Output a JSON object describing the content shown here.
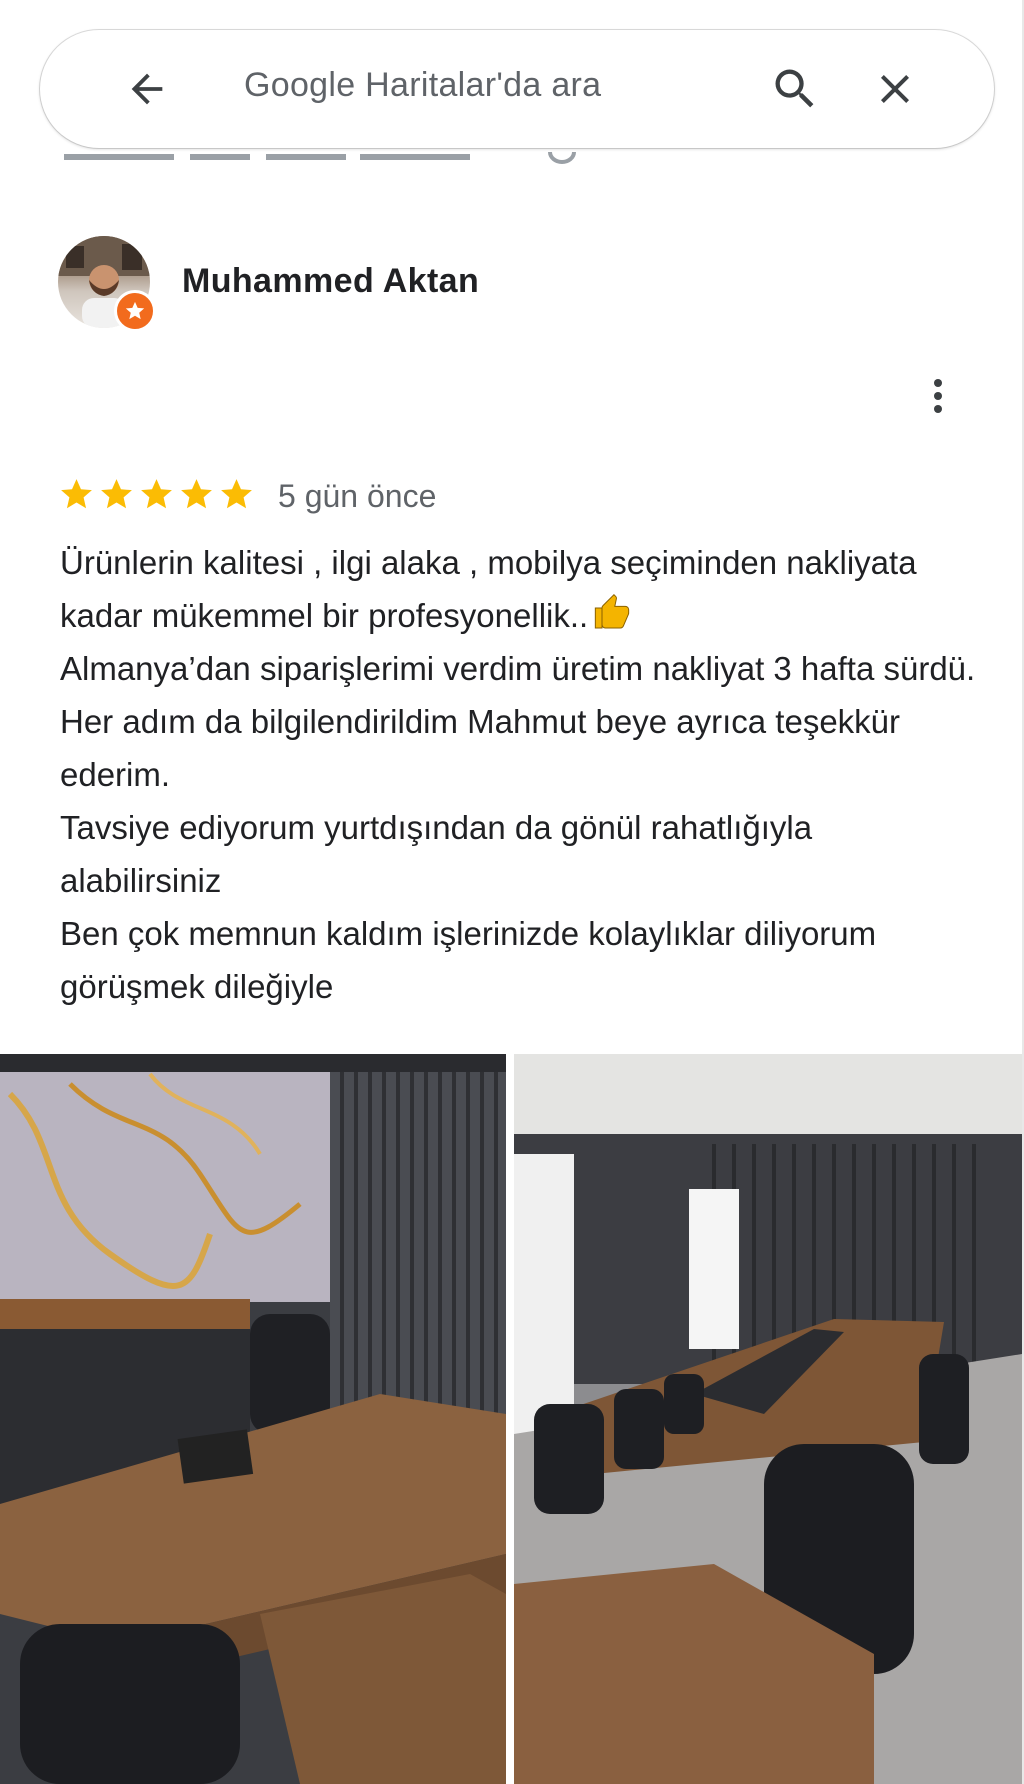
{
  "search": {
    "placeholder": "Google Haritalar'da ara",
    "back_icon": "arrow-left-icon",
    "search_icon": "search-icon",
    "close_icon": "close-icon"
  },
  "review": {
    "reviewer_name": "Muhammed Aktan",
    "local_guide_badge": "star-badge-icon",
    "rating": 5,
    "rating_max": 5,
    "date": "5 gün önce",
    "text_lines": [
      "Ürünlerin kalitesi , ilgi alaka , mobilya seçiminden nakliyata kadar mükemmel bir profesyonellik..",
      "Almanya’dan siparişlerimi verdim üretim nakliyat 3 hafta sürdü. Her adım da bilgilendirildim Mahmut beye ayrıca teşekkür ederim.",
      "Tavsiye ediyorum yurtdışından da gönül rahatlığıyla alabilirsiniz",
      "Ben çok memnun kaldım işlerinizde kolaylıklar diliyorum görüşmek dileğiyle"
    ],
    "emoji": "thumbs-up-icon",
    "more_icon": "more-vert-icon"
  },
  "photos": [
    {
      "subject": "office-desk-photo"
    },
    {
      "subject": "meeting-room-photo"
    }
  ],
  "colors": {
    "star": "#fbbc04",
    "badge": "#f26b1d",
    "text": "#202124",
    "secondary_text": "#5f6368"
  }
}
